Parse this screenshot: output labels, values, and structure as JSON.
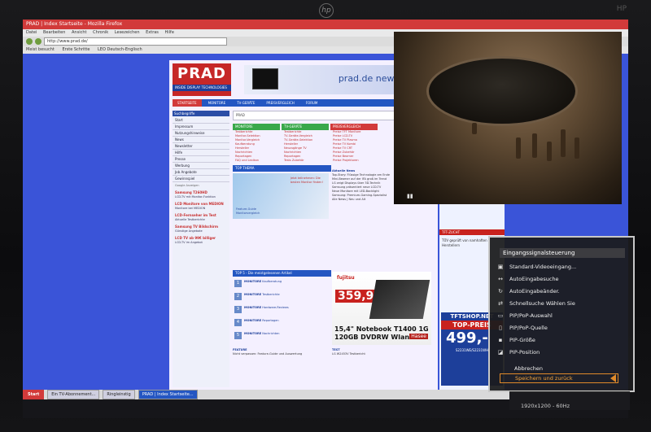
{
  "monitor": {
    "brand_right": "HP"
  },
  "browser": {
    "title": "PRAD | Index Startseite - Mozilla Firefox",
    "menu": [
      "Datei",
      "Bearbeiten",
      "Ansicht",
      "Chronik",
      "Lesezeichen",
      "Extras",
      "Hilfe"
    ],
    "url": "http://www.prad.de/",
    "bookmarks": [
      "Meist besucht",
      "Erste Schritte",
      "LEO Deutsch-Englisch"
    ]
  },
  "page": {
    "logo": {
      "big": "PRAD",
      "small": "INSIDE DISPLAY TECHNOLOGIES"
    },
    "newsletter": "prad.de newsletter",
    "topnav": [
      "STARTSEITE",
      "MONITORE",
      "TV-GERÄTE",
      "PREISVERGLEICH",
      "FORUM"
    ],
    "left_nav": {
      "head": "Suchbegriffe",
      "items": [
        "Start",
        "Impressum",
        "Nutzungshinweise",
        "News",
        "Newsletter",
        "Hilfe",
        "Presse",
        "Werbung",
        "Job Angebote",
        "Gewinnspiel"
      ],
      "google": "Google Anzeigen",
      "ads": [
        {
          "title": "Samsung T260HD",
          "text": "LCD-TV mit Monitor-Funktion"
        },
        {
          "title": "LCD Monitore von MEDION",
          "text": "Monitore bei MEDION"
        },
        {
          "title": "LCD-Fernseher im Test",
          "text": "Aktuelle Testberichte"
        },
        {
          "title": "Samsung TV Bildschirm",
          "text": "Günstige Angebote"
        },
        {
          "title": "LCD TV ab 99€ billiger",
          "text": "LCD-TV im Angebot"
        }
      ]
    },
    "search": {
      "label": "PRAD",
      "placeholder": ""
    },
    "categories": [
      {
        "head": "MONITORE",
        "color": "#3aa84a",
        "links": [
          "Testberichte",
          "Monitor-Selektion",
          "Monitor-Vergleich",
          "Kaufberatung",
          "Hersteller",
          "Nachrichten",
          "Reportagen",
          "FAQ und Lexikon"
        ]
      },
      {
        "head": "TV-GERÄTE",
        "color": "#3aa84a",
        "links": [
          "Testberichte",
          "TV-Geräte-Vergleich",
          "TV-Geräte-Selektion",
          "Hersteller",
          "Neuzugänge TV",
          "Nachrichten",
          "Reportagen",
          "Tests Zubehör"
        ]
      },
      {
        "head": "PREISVERGLEICH",
        "color": "#d23a3a",
        "links": [
          "Preise TFT Monitore",
          "Preise LCD-TV",
          "Preise TV Plasma",
          "Preise TV Kombi",
          "Preise TV CRT",
          "Preise Zubehör",
          "Preise Beamer",
          "Preise Projektoren"
        ]
      }
    ],
    "topthema": {
      "head": "TOP THEMA",
      "text": "Jetzt teilnehmen: Die besten Monitor finden!",
      "links": [
        "Feature-Guide",
        "Monitorvergleich"
      ]
    },
    "aktuell": {
      "head": "Aktuelle News",
      "lines": [
        "Top-Story: Flüssige Technologie am Ende",
        "Mini-Beamer auf der IFA groß im Trend",
        "LG zeigt Displays über 3D-Technik",
        "Samsung präsentiert neue LCD-TV",
        "Neue Monitore mit LED-Backlight",
        "Samsung: Premium-Gaming-Spezialist",
        "Alle News | Neu und Alt"
      ]
    },
    "top5": {
      "head": "TOP 5 - Die meistgelesenen Artikel",
      "items": [
        {
          "cat": "MONITORE",
          "text": "Kaufberatung"
        },
        {
          "cat": "MONITORE",
          "text": "Testberichte"
        },
        {
          "cat": "MONITORE",
          "text": "Hardware-Reviews"
        },
        {
          "cat": "MONITORE",
          "text": "Reportagen"
        },
        {
          "cat": "MONITORE",
          "text": "Nachrichten"
        }
      ]
    },
    "promo": {
      "brand": "fujitsu",
      "price": "359,99€",
      "title": "15,4\" Notebook T1400 1G 120GB DVDRW Wlan",
      "hasee": "Hasee"
    },
    "feature": {
      "head": "FEATURE",
      "text": "Nicht verpassen: Feature-Guide und Auswertung"
    },
    "test": {
      "head": "TEST",
      "text": "LG W2453V Testbericht"
    },
    "right_col": {
      "head1": "TFT-ZUGANG-NEWS",
      "head2": "TFT-ZUCHT",
      "tueb": "TÜV geprüft von namhaften Herstellern",
      "shop": {
        "a": "TFTSHOP.NET",
        "b": "TOP-PREIS",
        "c": "499,-",
        "d": "S2231WE/S2231WH"
      }
    }
  },
  "video": {
    "play_symbol": "▮▮"
  },
  "taskbar": {
    "start": "Start",
    "tasks": [
      {
        "label": "Ein TV-Abonnement...",
        "active": false
      },
      {
        "label": "Ringleinstig",
        "active": false
      },
      {
        "label": "PRAD | Index Startseite...",
        "active": true
      }
    ]
  },
  "osd": {
    "title": "Eingangssignalsteuerung",
    "items": [
      {
        "label": "Standard-Videoeingang...",
        "icon": "input-icon"
      },
      {
        "label": "AutoEingabesuche",
        "icon": "auto-icon"
      },
      {
        "label": "AutoEingabeänder.",
        "icon": "auto-change-icon"
      },
      {
        "label": "Schnellsuche Wählen Sie",
        "icon": "search-icon"
      },
      {
        "label": "PIP/PoP-Auswahl",
        "icon": "pip-icon"
      },
      {
        "label": "PIP/PoP-Quelle",
        "icon": "pip-source-icon"
      },
      {
        "label": "PIP-Größe",
        "icon": "pip-size-icon"
      },
      {
        "label": "PIP-Position",
        "icon": "pip-position-icon"
      }
    ],
    "cancel": "Abbrechen",
    "save": "Speichern und zurück",
    "resolution": "1920x1200 - 60Hz"
  }
}
